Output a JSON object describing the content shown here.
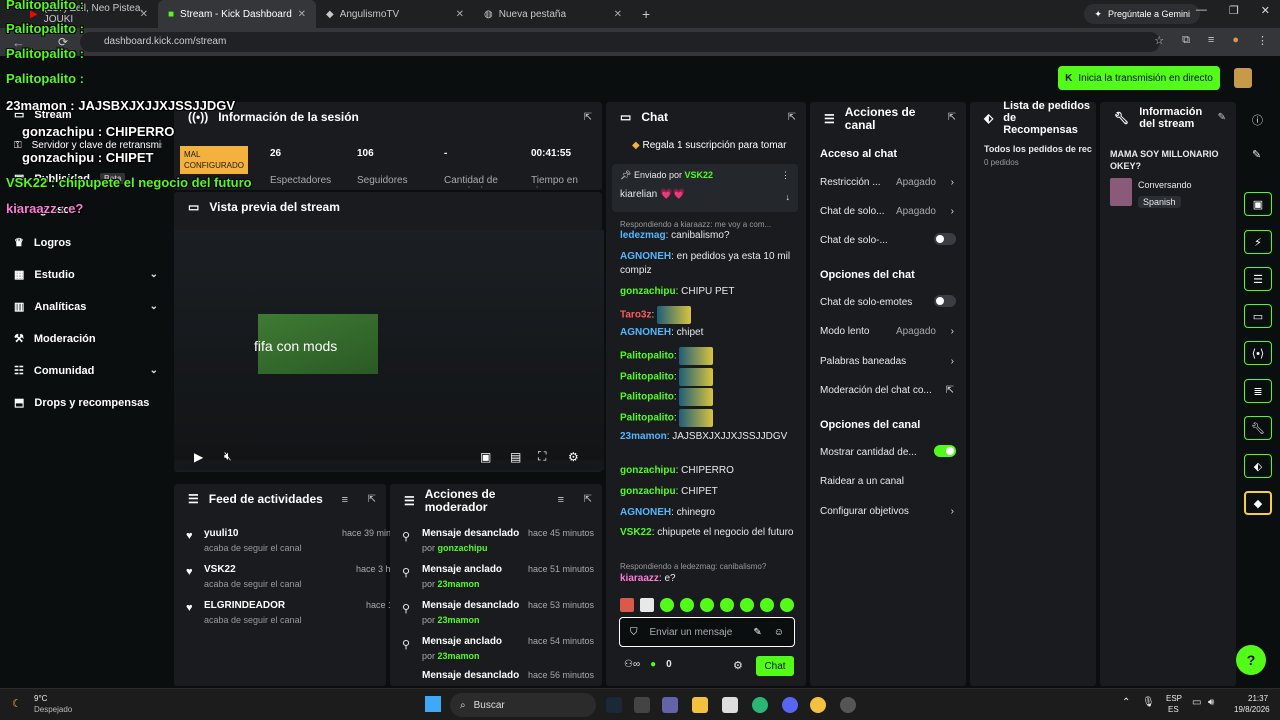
{
  "browser": {
    "tabs": [
      {
        "label": "(217) Zell, Neo Pistea, JOUKI"
      },
      {
        "label": "Stream - Kick Dashboard"
      },
      {
        "label": "AngulismoTV"
      },
      {
        "label": "Nueva pestaña"
      }
    ],
    "gemini": "Pregúntale a Gemini",
    "url": "dashboard.kick.com/stream"
  },
  "header": {
    "go_live": "Inicia la transmisión en directo"
  },
  "sidebar": {
    "items": [
      {
        "label": "Stream"
      },
      {
        "label": "Servidor y clave de retransmisión"
      },
      {
        "label": "Publicidad"
      },
      {
        "label": "Ingresos"
      },
      {
        "label": "Logros"
      },
      {
        "label": "Estudio"
      },
      {
        "label": "Analíticas"
      },
      {
        "label": "Moderación"
      },
      {
        "label": "Comunidad"
      },
      {
        "label": "Drops y recompensas"
      }
    ],
    "beta": "Beta"
  },
  "session": {
    "title": "Información de la sesión",
    "warning": "MAL CONFIGURADO",
    "stats": [
      {
        "value": "26",
        "label": "Espectadores"
      },
      {
        "value": "106",
        "label": "Seguidores"
      },
      {
        "value": "-",
        "label": "Cantidad de suscripciones"
      },
      {
        "value": "00:41:55",
        "label": "Tiempo en vivo"
      }
    ]
  },
  "preview": {
    "title": "Vista previa del stream",
    "overlay_text": "fifa con mods"
  },
  "activity": {
    "title": "Feed de actividades",
    "rows": [
      {
        "name": "yuuli10",
        "sub": "acaba de seguir el canal",
        "time": "hace 39 minutos"
      },
      {
        "name": "VSK22",
        "sub": "acaba de seguir el canal",
        "time": "hace 3 horas"
      },
      {
        "name": "ELGRINDEADOR",
        "sub": "acaba de seguir el canal",
        "time": "hace 1 día"
      }
    ]
  },
  "moderator": {
    "title": "Acciones de moderador",
    "rows": [
      {
        "name": "Mensaje desanclado",
        "by": "por",
        "user": "gonzachipu",
        "time": "hace 45 minutos"
      },
      {
        "name": "Mensaje anclado",
        "by": "por",
        "user": "23mamon",
        "time": "hace 51 minutos"
      },
      {
        "name": "Mensaje desanclado",
        "by": "por",
        "user": "23mamon",
        "time": "hace 53 minutos"
      },
      {
        "name": "Mensaje anclado",
        "by": "por",
        "user": "23mamon",
        "time": "hace 54 minutos"
      },
      {
        "name": "Mensaje desanclado",
        "by": "por",
        "user": "23mamon",
        "time": "hace 56 minutos"
      }
    ]
  },
  "chat": {
    "title": "Chat",
    "gift": "Regala 1 suscripción para tomar",
    "pinned_by": "Enviado por",
    "pinned_user": "VSK22",
    "pinned_msg": "kiarelian 💗💗",
    "reply1": "Respondiendo a kiaraazz: me voy a com...",
    "messages": [
      {
        "user": "ledezmag",
        "color": "#53b8ff",
        "text": ": canibalismo?"
      },
      {
        "user": "AGNONEH",
        "color": "#53b8ff",
        "text": ": en pedidos ya esta 10 mil compiz"
      },
      {
        "user": "gonzachipu",
        "color": "#53fc18",
        "text": ": CHIPU PET"
      },
      {
        "user": "Taro3z",
        "color": "#ff5a5a",
        "text": ":"
      },
      {
        "user": "AGNONEH",
        "color": "#53b8ff",
        "text": ": chipet"
      },
      {
        "user": "Palitopalito",
        "color": "#53fc18",
        "text": ":"
      },
      {
        "user": "Palitopalito",
        "color": "#53fc18",
        "text": ":"
      },
      {
        "user": "Palitopalito",
        "color": "#53fc18",
        "text": ":"
      },
      {
        "user": "Palitopalito",
        "color": "#53fc18",
        "text": ":"
      },
      {
        "user": "23mamon",
        "color": "#53b8ff",
        "text": ": JAJSBXJXJJXJSSJJDGV"
      },
      {
        "user": "gonzachipu",
        "color": "#53fc18",
        "text": ": CHIPERRO"
      },
      {
        "user": "gonzachipu",
        "color": "#53fc18",
        "text": ": CHIPET"
      },
      {
        "user": "AGNONEH",
        "color": "#53b8ff",
        "text": ": chinegro"
      },
      {
        "user": "VSK22",
        "color": "#53fc18",
        "text": ": chipupete el negocio del futuro"
      }
    ],
    "reply2": "Respondiendo a ledezmag: canibalismo?",
    "last": {
      "user": "kiaraazz",
      "color": "#ff7ad9",
      "text": ": e?"
    },
    "input_placeholder": "Enviar un mensaje",
    "points": "0",
    "send": "Chat"
  },
  "channel": {
    "title": "Acciones de canal",
    "sections": [
      {
        "title": "Acceso al chat"
      },
      {
        "title": "Opciones del chat"
      },
      {
        "title": "Opciones del canal"
      }
    ],
    "options": [
      {
        "label": "Restricción ...",
        "value": "Apagado"
      },
      {
        "label": "Chat de solo...",
        "value": "Apagado"
      },
      {
        "label": "Chat de solo-...",
        "value": ""
      },
      {
        "label": "Chat de solo-emotes",
        "value": ""
      },
      {
        "label": "Modo lento",
        "value": "Apagado"
      },
      {
        "label": "Palabras baneadas",
        "value": ""
      },
      {
        "label": "Moderación del chat co...",
        "value": ""
      },
      {
        "label": "Mostrar cantidad de...",
        "value": ""
      },
      {
        "label": "Raidear a un canal",
        "value": ""
      },
      {
        "label": "Configurar objetivos",
        "value": ""
      }
    ]
  },
  "rewards": {
    "title": "Lista de pedidos de Recompensas",
    "all": "Todos los pedidos de rec",
    "count": "0 pedidos"
  },
  "streaminfo": {
    "title": "Información del stream",
    "stream_title": "MAMA SOY MILLONARIO OKEY?",
    "category": "Conversando",
    "language": "Spanish"
  },
  "overlay_chat": [
    {
      "text": "Palitopalito :"
    },
    {
      "text": "Palitopalito :"
    },
    {
      "text": "Palitopalito :"
    },
    {
      "text": "Palitopalito :"
    },
    {
      "text": "23mamon : JAJSBXJXJJXJSSJJDGV"
    },
    {
      "text": "gonzachipu : CHIPERRO"
    },
    {
      "text": "gonzachipu : CHIPET"
    },
    {
      "text": "VSK22 : chipupete el negocio del futuro"
    },
    {
      "text": "kiaraazz : e?"
    }
  ],
  "taskbar": {
    "weather_temp": "9°C",
    "weather_desc": "Despejado",
    "search": "Buscar",
    "lang1": "ESP",
    "lang2": "ES",
    "time": "21:37",
    "date": "19/8/2026"
  }
}
